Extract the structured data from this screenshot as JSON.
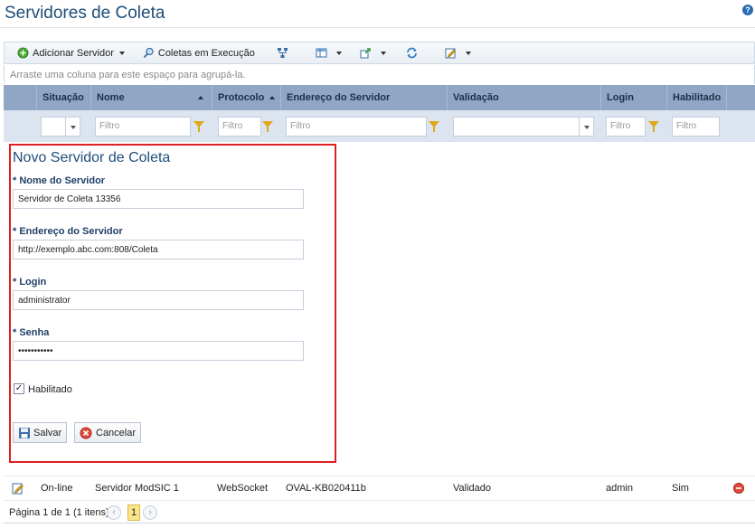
{
  "page": {
    "title": "Servidores de Coleta",
    "help_glyph": "?"
  },
  "toolbar": {
    "add_server": "Adicionar Servidor",
    "running_collections": "Coletas em Execução"
  },
  "group_hint": "Arraste uma coluna para este espaço para agrupá-la.",
  "columns": {
    "situacao": "Situação",
    "nome": "Nome",
    "protocolo": "Protocolo",
    "endereco": "Endereço do Servidor",
    "validacao": "Validação",
    "login": "Login",
    "habilitado": "Habilitado"
  },
  "filter": {
    "placeholder": "Filtro"
  },
  "form": {
    "title": "Novo Servidor de Coleta",
    "name_label": "* Nome do Servidor",
    "name_value": "Servidor de Coleta 13356",
    "address_label": "* Endereço do Servidor",
    "address_value": "http://exemplo.abc.com:808/Coleta",
    "login_label": "* Login",
    "login_value": "administrator",
    "password_label": "* Senha",
    "password_value": "•••••••••••",
    "enabled_label": "Habilitado",
    "enabled_checked": true,
    "save_label": "Salvar",
    "cancel_label": "Cancelar"
  },
  "rows": [
    {
      "situacao": "On-line",
      "nome": "Servidor ModSIC 1",
      "protocolo": "WebSocket",
      "endereco": "OVAL-KB020411b",
      "validacao": "Validado",
      "login": "admin",
      "habilitado": "Sim"
    }
  ],
  "pager": {
    "text": "Página 1 de 1 (1 itens)",
    "current_page": "1",
    "prev": "‹",
    "next": "›"
  },
  "colors": {
    "accent": "#1f4e79",
    "header_bg": "#8fa6c4",
    "filter_bg": "#dbe4ef",
    "highlight_border": "#e02020"
  }
}
